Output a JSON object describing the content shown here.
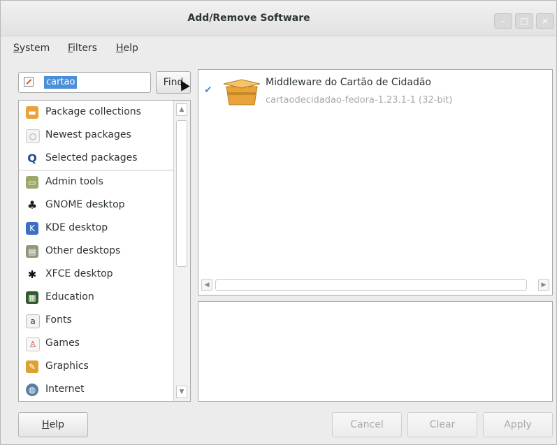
{
  "window": {
    "title": "Add/Remove Software",
    "controls": {
      "minimize": "–",
      "maximize": "□",
      "close": "×"
    }
  },
  "menubar": {
    "items": [
      {
        "label": "System",
        "mnemonic": "S",
        "rest": "ystem"
      },
      {
        "label": "Filters",
        "mnemonic": "F",
        "rest": "ilters"
      },
      {
        "label": "Help",
        "mnemonic": "H",
        "rest": "elp"
      }
    ]
  },
  "search": {
    "value": "cartao",
    "find_label": "Find"
  },
  "categories": [
    {
      "label": "Package collections",
      "icon": "package-collections-icon"
    },
    {
      "label": "Newest packages",
      "icon": "lightbulb-icon"
    },
    {
      "label": "Selected packages",
      "icon": "magnifier-icon"
    },
    {
      "label": "Admin tools",
      "icon": "admin-tools-icon"
    },
    {
      "label": "GNOME desktop",
      "icon": "gnome-foot-icon"
    },
    {
      "label": "KDE desktop",
      "icon": "kde-icon"
    },
    {
      "label": "Other desktops",
      "icon": "other-desktops-icon"
    },
    {
      "label": "XFCE desktop",
      "icon": "xfce-mouse-icon"
    },
    {
      "label": "Education",
      "icon": "education-icon"
    },
    {
      "label": "Fonts",
      "icon": "fonts-icon"
    },
    {
      "label": "Games",
      "icon": "games-icon"
    },
    {
      "label": "Graphics",
      "icon": "graphics-icon"
    },
    {
      "label": "Internet",
      "icon": "internet-globe-icon"
    }
  ],
  "packages": [
    {
      "name": "Middleware do Cartão de Cidadão",
      "version": "cartaodecidadao-fedora-1.23.1-1 (32-bit)",
      "checked": true
    }
  ],
  "buttons": {
    "help": {
      "label": "Help",
      "mnemonic": "H",
      "rest": "elp"
    },
    "cancel": "Cancel",
    "clear": "Clear",
    "apply": "Apply"
  },
  "colors": {
    "accent": "#4a90d9",
    "box": "#e8a33a"
  }
}
